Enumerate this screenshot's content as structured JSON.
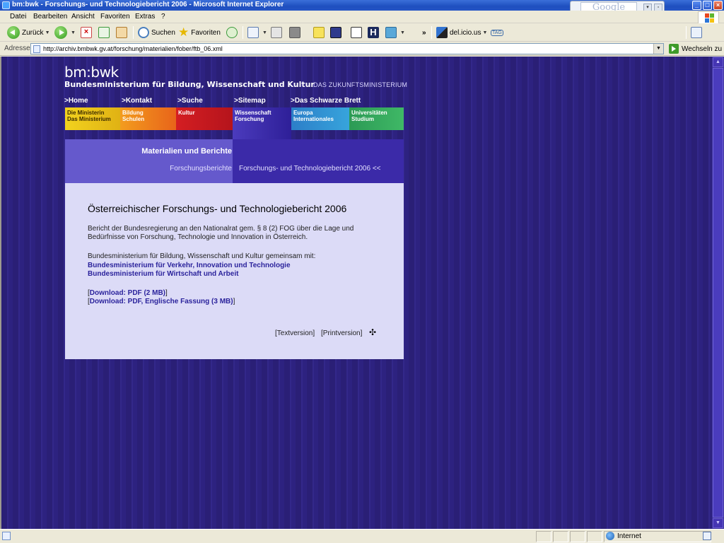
{
  "window": {
    "title": "bm:bwk - Forschungs- und Technologiebericht 2006 - Microsoft Internet Explorer"
  },
  "google_box": {
    "label": "Google"
  },
  "menu": [
    "Datei",
    "Bearbeiten",
    "Ansicht",
    "Favoriten",
    "Extras",
    "?"
  ],
  "toolbar": {
    "back": "Zurück",
    "search": "Suchen",
    "favorites": "Favoriten",
    "delicious": "del.icio.us",
    "tag": "TAG",
    "chevron": "»"
  },
  "address": {
    "label": "Adresse",
    "url": "http://archiv.bmbwk.gv.at/forschung/materialien/fober/ftb_06.xml",
    "go": "Wechseln zu"
  },
  "site": {
    "brand": "bm:bwk",
    "ministry": "Bundesministerium für Bildung, Wissenschaft und Kultur",
    "tagline": "DAS ZUKUNFTSMINISTERIUM",
    "topnav": [
      ">Home",
      ">Kontakt",
      ">Suche",
      ">Sitemap",
      ">Das Schwarze Brett"
    ],
    "sections": [
      {
        "line1": "Die Ministerin",
        "line2": "Das Ministerium",
        "color": "#e8c21a"
      },
      {
        "line1": "Bildung",
        "line2": "Schulen",
        "color": "#ef7a1a"
      },
      {
        "line1": "Kultur",
        "line2": "",
        "color": "#c8181e"
      },
      {
        "line1": "Wissenschaft",
        "line2": "Forschung",
        "color": "#3b2aa8"
      },
      {
        "line1": "Europa",
        "line2": "Internationales",
        "color": "#2a8fd0"
      },
      {
        "line1": "Universitäten",
        "line2": "Studium",
        "color": "#2fa35a"
      }
    ],
    "band": {
      "title": "Materialien und Berichte",
      "crumb": "Forschungsberichte",
      "current": "Forschungs- und Technologiebericht 2006 <<"
    },
    "content": {
      "heading": "Österreichischer Forschungs- und Technologiebericht 2006",
      "intro_line1": "Bericht der Bundesregierung an den Nationalrat gem. § 8 (2) FOG über die Lage und",
      "intro_line2": "Bedürfnisse von Forschung, Technologie und Innovation in Österreich.",
      "partners_intro": "Bundesministerium für Bildung, Wissenschaft und Kultur gemeinsam mit:",
      "partner1": "Bundesministerium für Verkehr, Innovation und Technologie",
      "partner2": "Bundesministerium für Wirtschaft und Arbeit",
      "download1": "Download: PDF (2 MB)",
      "download2": "Download: PDF, Englische Fassung (3 MB)",
      "textversion": "[Textversion]",
      "printversion": "[Printversion]"
    }
  },
  "status": {
    "zone": "Internet"
  }
}
